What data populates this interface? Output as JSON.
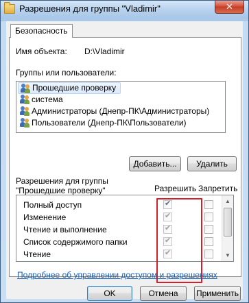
{
  "window": {
    "title": "Разрешения для группы \"Vladimir\"",
    "close_glyph": "✕"
  },
  "tabs": [
    {
      "label": "Безопасность"
    }
  ],
  "object": {
    "label": "Имя объекта:",
    "value": "D:\\Vladimir"
  },
  "groups": {
    "label": "Группы или пользователи:",
    "items": [
      {
        "label": "Прошедшие проверку",
        "icon": "users-icon",
        "selected": true
      },
      {
        "label": "система",
        "icon": "users-icon",
        "selected": false
      },
      {
        "label": "Администраторы (Днепр-ПК\\Администраторы)",
        "icon": "users-icon",
        "selected": false
      },
      {
        "label": "Пользователи (Днепр-ПК\\Пользователи)",
        "icon": "users-icon",
        "selected": false
      }
    ],
    "add_button": "Добавить...",
    "remove_button": "Удалить"
  },
  "permissions": {
    "title_line1": "Разрешения для группы",
    "title_line2": "\"Прошедшие проверку\"",
    "allow_header": "Разрешить",
    "deny_header": "Запретить",
    "rows": [
      {
        "name": "Полный доступ",
        "allow": true,
        "deny": false
      },
      {
        "name": "Изменение",
        "allow": true,
        "deny": false
      },
      {
        "name": "Чтение и выполнение",
        "allow": true,
        "deny": false
      },
      {
        "name": "Список содержимого папки",
        "allow": true,
        "deny": false
      },
      {
        "name": "Чтение",
        "allow": true,
        "deny": false
      }
    ],
    "scroll_up": "▲",
    "scroll_down": "▼"
  },
  "help_link": "Подробнее об управлении доступом и разрешениях",
  "footer": {
    "ok": "OK",
    "cancel": "Отмена",
    "apply": "Применить"
  },
  "colors": {
    "highlight_border": "#d21f2a",
    "link": "#1a5fb4"
  }
}
